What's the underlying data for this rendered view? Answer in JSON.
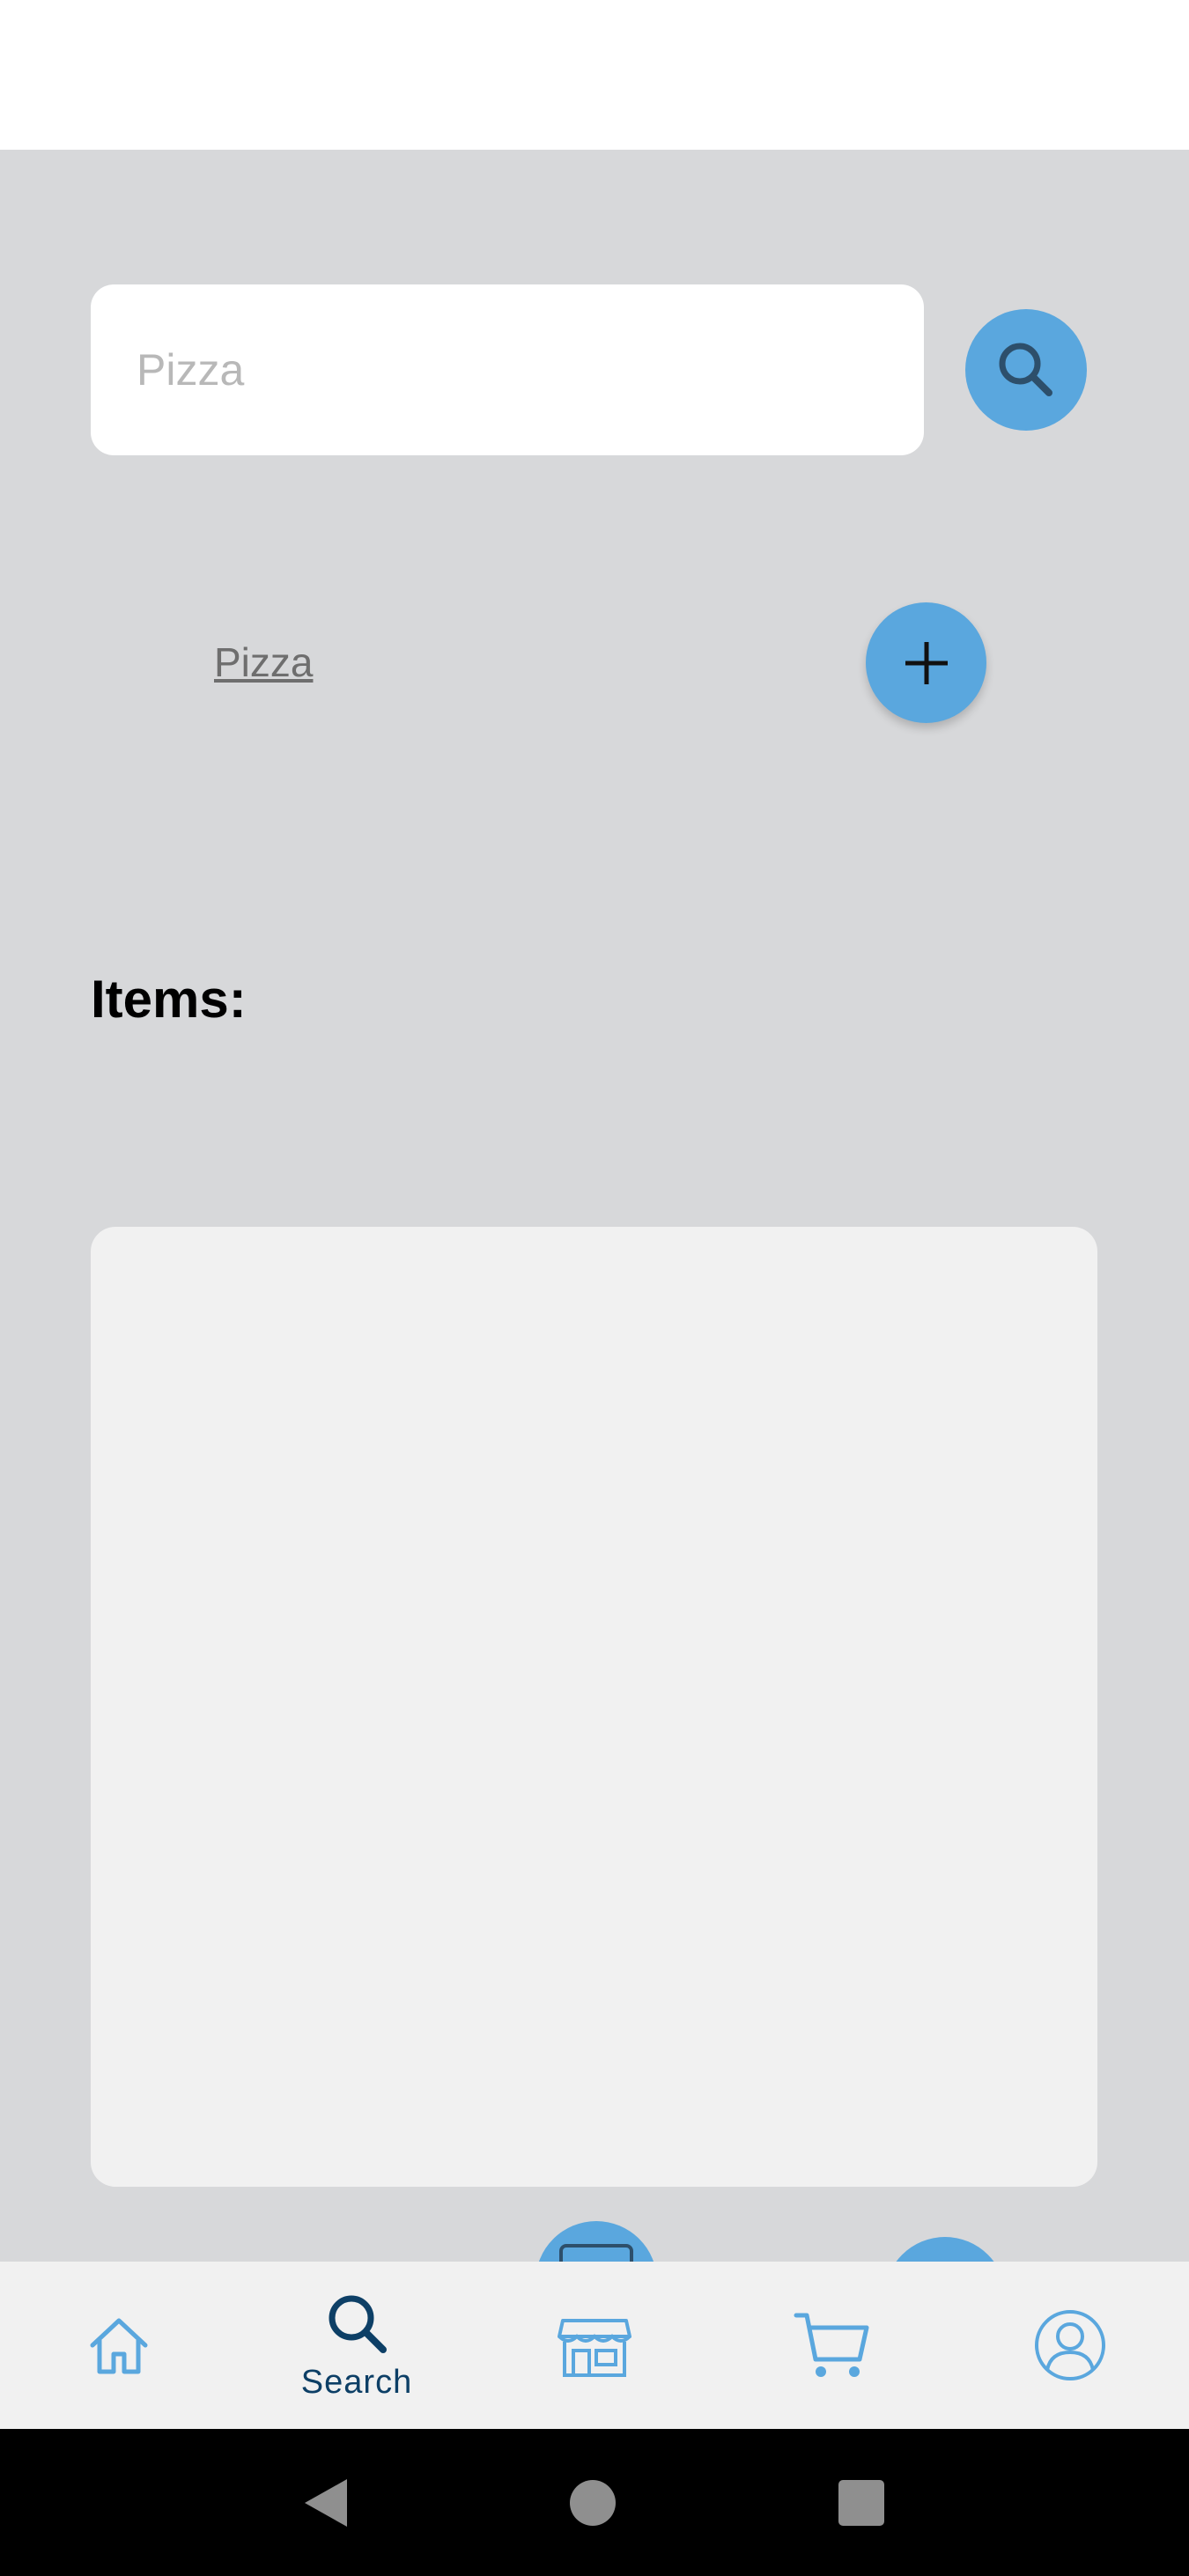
{
  "search": {
    "value": "",
    "placeholder": "Pizza"
  },
  "result": {
    "label": "Pizza",
    "add_icon": "plus-icon"
  },
  "items_section": {
    "heading": "Items:"
  },
  "bottom_nav": {
    "items": [
      {
        "name": "home",
        "icon": "home-icon",
        "label": ""
      },
      {
        "name": "search",
        "icon": "search-icon",
        "label": "Search",
        "active": true
      },
      {
        "name": "store",
        "icon": "store-icon",
        "label": ""
      },
      {
        "name": "cart",
        "icon": "cart-icon",
        "label": ""
      },
      {
        "name": "profile",
        "icon": "user-icon",
        "label": ""
      }
    ]
  },
  "colors": {
    "accent": "#5aa7de",
    "active_nav": "#0d3f66",
    "background": "#d7d8da",
    "panel": "#f1f1f1"
  }
}
